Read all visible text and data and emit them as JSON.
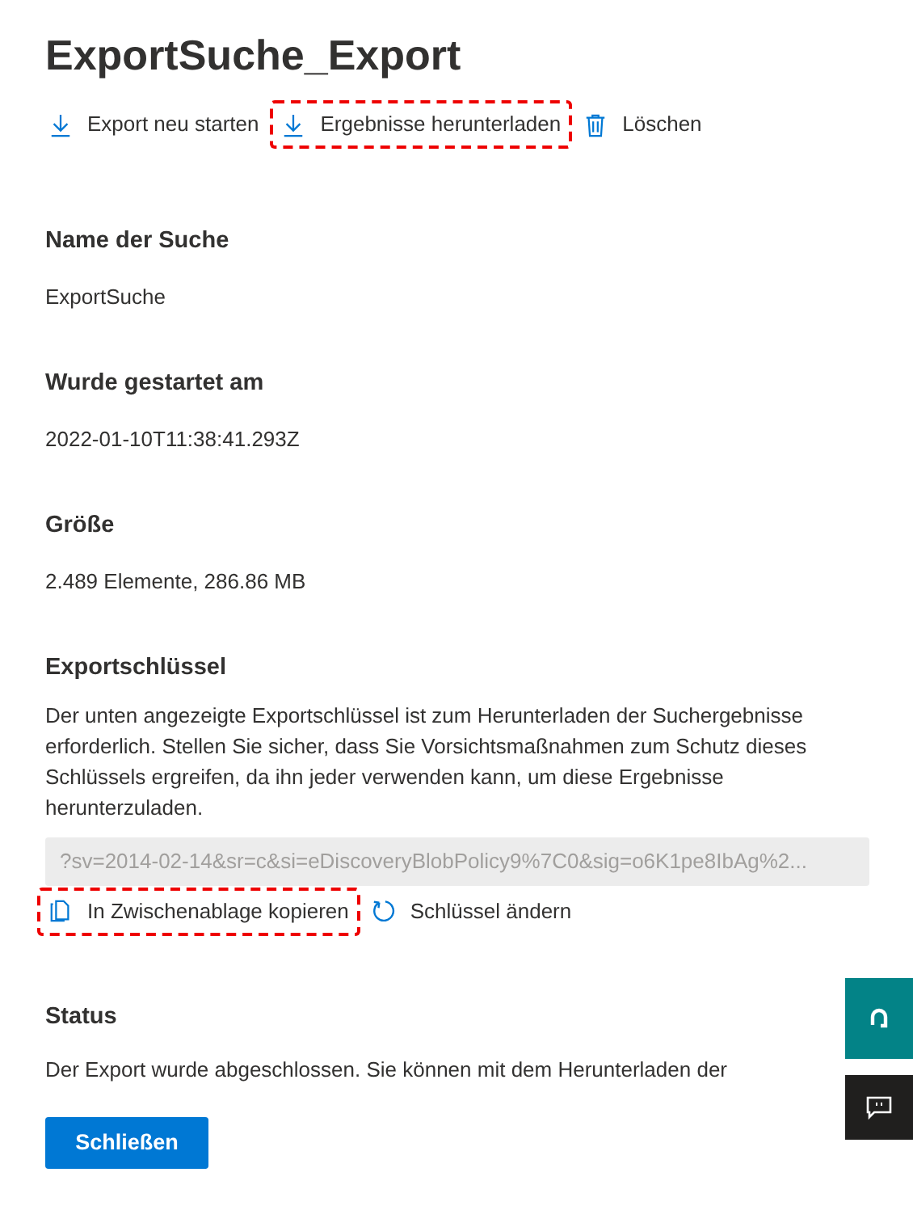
{
  "title": "ExportSuche_Export",
  "actions": [
    {
      "label": "Export neu starten",
      "kind": "download",
      "highlighted": false
    },
    {
      "label": "Ergebnisse herunterladen",
      "kind": "download",
      "highlighted": true
    },
    {
      "label": "Löschen",
      "kind": "delete",
      "highlighted": false
    }
  ],
  "sections": [
    {
      "heading": "Name der Suche",
      "value": "ExportSuche"
    },
    {
      "heading": "Wurde gestartet am",
      "value": "2022-01-10T11:38:41.293Z"
    },
    {
      "heading": "Größe",
      "value": "2.489 Elemente, 286.86 MB"
    }
  ],
  "export_key": {
    "heading": "Exportschlüssel",
    "description": "Der unten angezeigte Exportschlüssel ist zum Herunterladen der Suchergebnisse erforderlich. Stellen Sie sicher, dass Sie Vorsichtsmaßnahmen zum Schutz dieses Schlüssels ergreifen, da ihn jeder verwenden kann, um diese Ergebnisse herunterzuladen.",
    "value": "?sv=2014-02-14&sr=c&si=eDiscoveryBlobPolicy9%7C0&sig=o6K1pe8IbAg%2...",
    "actions": [
      {
        "label": "In Zwischenablage kopieren",
        "kind": "copy",
        "highlighted": true
      },
      {
        "label": "Schlüssel ändern",
        "kind": "refresh",
        "highlighted": false
      }
    ]
  },
  "status": {
    "heading": "Status",
    "text": "Der Export wurde abgeschlossen. Sie können mit dem Herunterladen der"
  },
  "close_button": "Schließen",
  "side_buttons": [
    {
      "kind": "help"
    },
    {
      "kind": "feedback"
    }
  ]
}
